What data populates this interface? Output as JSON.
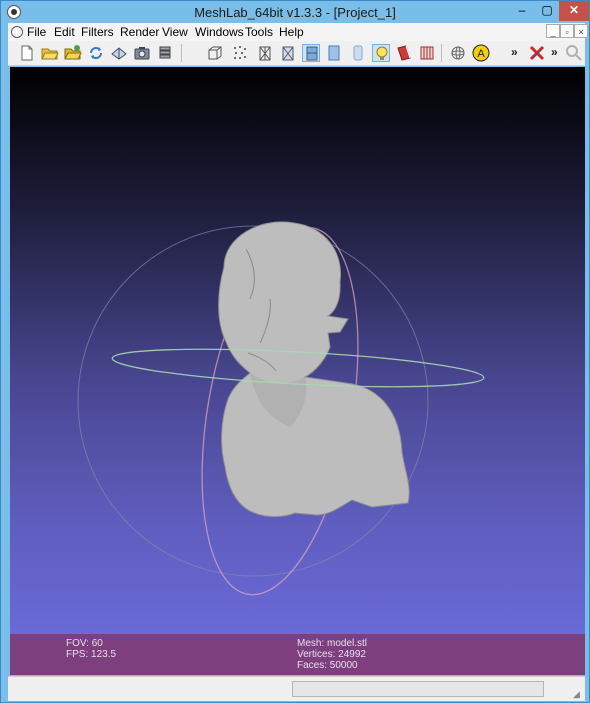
{
  "window": {
    "title": "MeshLab_64bit v1.3.3 - [Project_1]"
  },
  "window_controls": {
    "minimize": "–",
    "maximize": "▢",
    "close": "✕"
  },
  "menubar": {
    "items": [
      "File",
      "Edit",
      "Filters",
      "Render",
      "View",
      "Windows",
      "Tools",
      "Help"
    ],
    "mdi_controls": [
      "_",
      "▫",
      "×"
    ]
  },
  "toolbar": {
    "overflow_label_1": "»",
    "overflow_label_2": "»",
    "buttons": [
      "new-project",
      "open",
      "open-project",
      "reload",
      "save-project",
      "snapshot",
      "layers",
      "bounding-box",
      "points",
      "wireframe",
      "hidden-lines",
      "flat-lines",
      "flat",
      "smooth",
      "lighting",
      "back-face",
      "texture",
      "trackball",
      "annotate",
      "delete",
      "find"
    ],
    "accent_color": "#f0d000"
  },
  "viewport": {
    "background_top": "#000000",
    "background_bottom": "#6a6ad8",
    "mesh_color": "#bcbcbc"
  },
  "info": {
    "fov": "FOV: 60",
    "fps": "FPS:   123.5",
    "mesh": "Mesh: model.stl",
    "vertices": "Vertices: 24992",
    "faces": "Faces: 50000",
    "bar_color": "#7e3f7f"
  }
}
